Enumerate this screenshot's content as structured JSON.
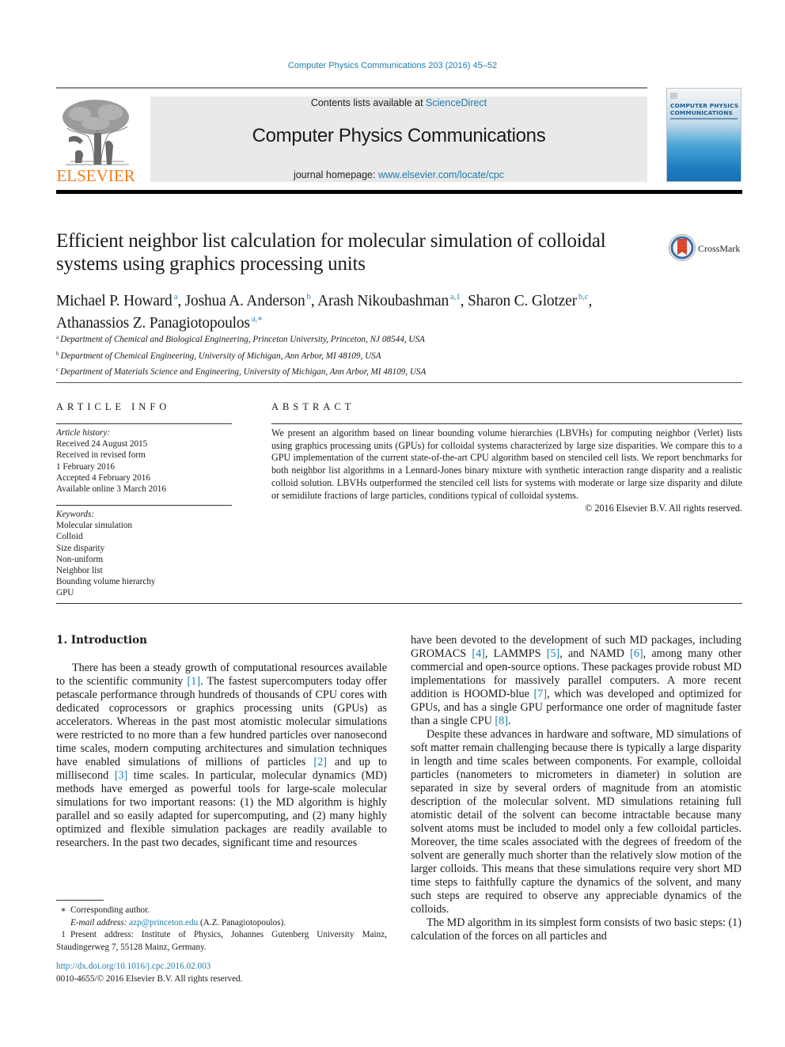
{
  "running_header": "Computer Physics Communications 203 (2016) 45–52",
  "publisher": {
    "name": "ELSEVIER",
    "logo_icon": "elsevier-tree-icon",
    "brand_color": "#f07d1d"
  },
  "masthead": {
    "contents_prefix": "Contents lists available at ",
    "contents_link": "ScienceDirect",
    "journal_title": "Computer Physics Communications",
    "homepage_prefix": "journal homepage: ",
    "homepage_link": "www.elsevier.com/locate/cpc",
    "banner_color": "#e9e9e9",
    "link_color": "#1f7cad"
  },
  "cover": {
    "title_line1": "COMPUTER PHYSICS",
    "title_line2": "COMMUNICATIONS"
  },
  "article": {
    "title": "Efficient neighbor list calculation for molecular simulation of colloidal systems using graphics processing units",
    "crossmark_label": "CrossMark",
    "authors": [
      {
        "name": "Michael P. Howard",
        "sup": "a",
        "sep": ", "
      },
      {
        "name": "Joshua A. Anderson",
        "sup": "b",
        "sep": ", "
      },
      {
        "name": "Arash Nikoubashman",
        "sup": "a,1",
        "sep": ", "
      },
      {
        "name": "Sharon C. Glotzer",
        "sup": "b,c",
        "sep": ","
      },
      {
        "name": "Athanassios Z. Panagiotopoulos",
        "sup": "a,∗",
        "sep": ""
      }
    ],
    "affiliations": [
      {
        "mark": "a",
        "text": "Department of Chemical and Biological Engineering, Princeton University, Princeton, NJ 08544, USA"
      },
      {
        "mark": "b",
        "text": "Department of Chemical Engineering, University of Michigan, Ann Arbor, MI 48109, USA"
      },
      {
        "mark": "c",
        "text": "Department of Materials Science and Engineering, University of Michigan, Ann Arbor, MI 48109, USA"
      }
    ]
  },
  "article_info": {
    "heading": "ARTICLE INFO",
    "history_label": "Article history:",
    "history": [
      "Received 24 August 2015",
      "Received in revised form",
      "1 February 2016",
      "Accepted 4 February 2016",
      "Available online 3 March 2016"
    ],
    "keywords_label": "Keywords:",
    "keywords": [
      "Molecular simulation",
      "Colloid",
      "Size disparity",
      "Non-uniform",
      "Neighbor list",
      "Bounding volume hierarchy",
      "GPU"
    ]
  },
  "abstract": {
    "heading": "ABSTRACT",
    "text": "We present an algorithm based on linear bounding volume hierarchies (LBVHs) for computing neighbor (Verlet) lists using graphics processing units (GPUs) for colloidal systems characterized by large size disparities. We compare this to a GPU implementation of the current state-of-the-art CPU algorithm based on stenciled cell lists. We report benchmarks for both neighbor list algorithms in a Lennard-Jones binary mixture with synthetic interaction range disparity and a realistic colloid solution. LBVHs outperformed the stenciled cell lists for systems with moderate or large size disparity and dilute or semidilute fractions of large particles, conditions typical of colloidal systems.",
    "copyright": "© 2016 Elsevier B.V. All rights reserved."
  },
  "body": {
    "section_title": "1.  Introduction",
    "left_p1": [
      "There has been a steady growth of computational resources available to the scientific community ",
      "[1]",
      ". The fastest supercomputers today offer petascale performance through hundreds of thousands of CPU cores with dedicated coprocessors or graphics processing units (GPUs) as accelerators. Whereas in the past most atomistic molecular simulations were restricted to no more than a few hundred particles over nanosecond time scales, modern computing architectures and simulation techniques have enabled simulations of millions of particles ",
      "[2]",
      " and up to millisecond ",
      "[3]",
      " time scales. In particular, molecular dynamics (MD) methods have emerged as powerful tools for large-scale molecular simulations for two important reasons: (1) the MD algorithm is highly parallel and so easily adapted for supercomputing, and (2) many highly optimized and flexible simulation packages are readily available to researchers. In the past two decades, significant time and resources"
    ],
    "right_p1": [
      "have been devoted to the development of such MD packages, including GROMACS ",
      "[4]",
      ", LAMMPS ",
      "[5]",
      ", and NAMD ",
      "[6]",
      ", among many other commercial and open-source options. These packages provide robust MD implementations for massively parallel computers. A more recent addition is HOOMD-blue ",
      "[7]",
      ", which was developed and optimized for GPUs, and has a single GPU performance one order of magnitude faster than a single CPU ",
      "[8]",
      "."
    ],
    "right_p2": "Despite these advances in hardware and software, MD simulations of soft matter remain challenging because there is typically a large disparity in length and time scales between components. For example, colloidal particles (nanometers to micrometers in diameter) in solution are separated in size by several orders of magnitude from an atomistic description of the molecular solvent. MD simulations retaining full atomistic detail of the solvent can become intractable because many solvent atoms must be included to model only a few colloidal particles. Moreover, the time scales associated with the degrees of freedom of the solvent are generally much shorter than the relatively slow motion of the larger colloids. This means that these simulations require very short MD time steps to faithfully capture the dynamics of the solvent, and many such steps are required to observe any appreciable dynamics of the colloids.",
    "right_p3": "The MD algorithm in its simplest form consists of two basic steps: (1) calculation of the forces on all particles and"
  },
  "footnotes": {
    "corresponding_mark": "∗",
    "corresponding_text": "Corresponding author.",
    "email_label": "E-mail address: ",
    "email": "azp@princeton.edu",
    "email_suffix": " (A.Z. Panagiotopoulos).",
    "present_mark": "1",
    "present_text": "Present address: Institute of Physics, Johannes Gutenberg University Mainz, Staudingerweg 7, 55128 Mainz, Germany."
  },
  "doi": {
    "link": "http://dx.doi.org/10.1016/j.cpc.2016.02.003",
    "issn_line": "0010-4655/© 2016 Elsevier B.V. All rights reserved."
  }
}
